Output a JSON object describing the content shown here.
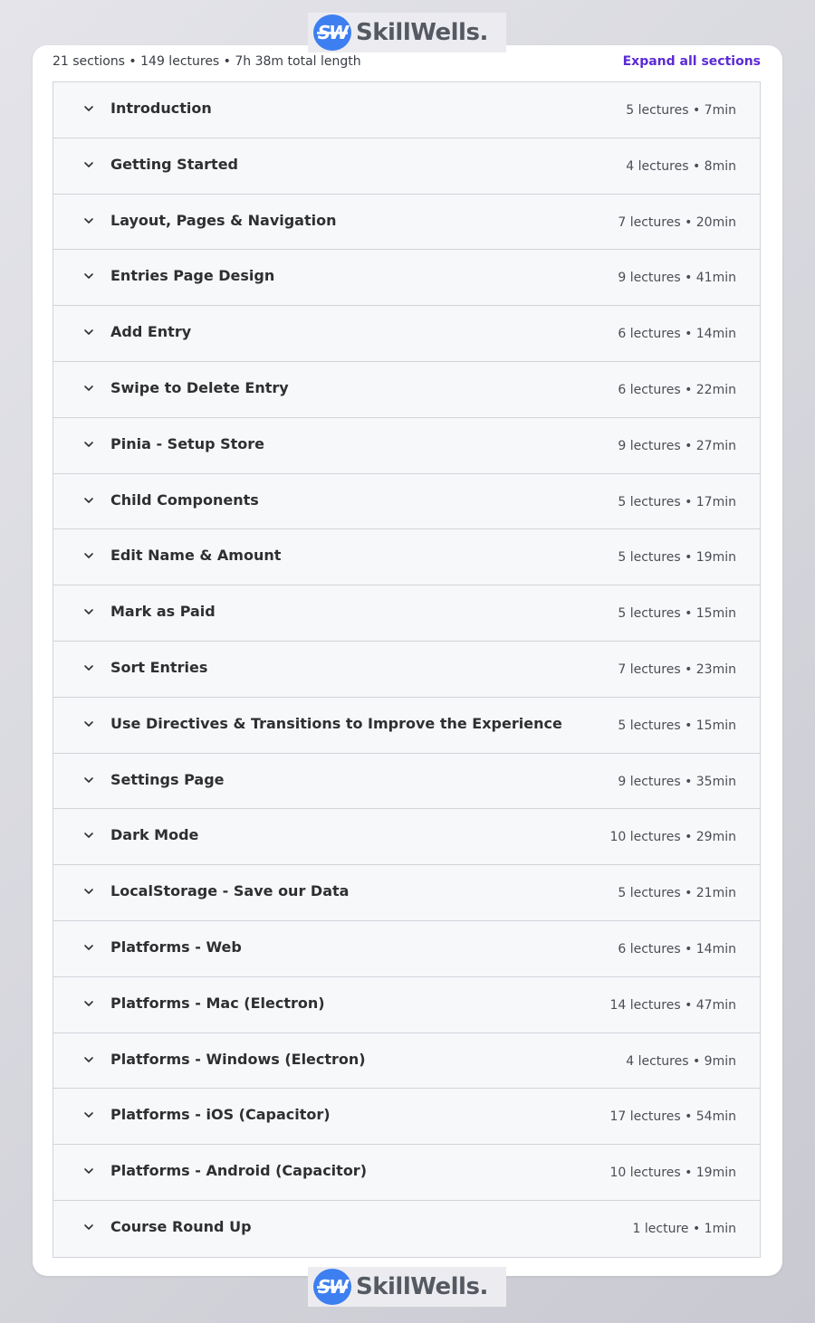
{
  "brand": {
    "mark": "SW",
    "name": "SkillWells."
  },
  "summary": {
    "text": "21 sections • 149 lectures • 7h 38m total length",
    "expand_label": "Expand all sections"
  },
  "sections": [
    {
      "title": "Introduction",
      "meta": "5 lectures • 7min"
    },
    {
      "title": "Getting Started",
      "meta": "4 lectures • 8min"
    },
    {
      "title": "Layout, Pages & Navigation",
      "meta": "7 lectures • 20min"
    },
    {
      "title": "Entries Page Design",
      "meta": "9 lectures • 41min"
    },
    {
      "title": "Add Entry",
      "meta": "6 lectures • 14min"
    },
    {
      "title": "Swipe to Delete Entry",
      "meta": "6 lectures • 22min"
    },
    {
      "title": "Pinia - Setup Store",
      "meta": "9 lectures • 27min"
    },
    {
      "title": "Child Components",
      "meta": "5 lectures • 17min"
    },
    {
      "title": "Edit Name & Amount",
      "meta": "5 lectures • 19min"
    },
    {
      "title": "Mark as Paid",
      "meta": "5 lectures • 15min"
    },
    {
      "title": "Sort Entries",
      "meta": "7 lectures • 23min"
    },
    {
      "title": "Use Directives & Transitions to Improve the Experience",
      "meta": "5 lectures • 15min"
    },
    {
      "title": "Settings Page",
      "meta": "9 lectures • 35min"
    },
    {
      "title": "Dark Mode",
      "meta": "10 lectures • 29min"
    },
    {
      "title": "LocalStorage - Save our Data",
      "meta": "5 lectures • 21min"
    },
    {
      "title": "Platforms - Web",
      "meta": "6 lectures • 14min"
    },
    {
      "title": "Platforms - Mac (Electron)",
      "meta": "14 lectures • 47min"
    },
    {
      "title": "Platforms - Windows (Electron)",
      "meta": "4 lectures • 9min"
    },
    {
      "title": "Platforms - iOS (Capacitor)",
      "meta": "17 lectures • 54min"
    },
    {
      "title": "Platforms - Android (Capacitor)",
      "meta": "10 lectures • 19min"
    },
    {
      "title": "Course Round Up",
      "meta": "1 lecture • 1min"
    }
  ]
}
